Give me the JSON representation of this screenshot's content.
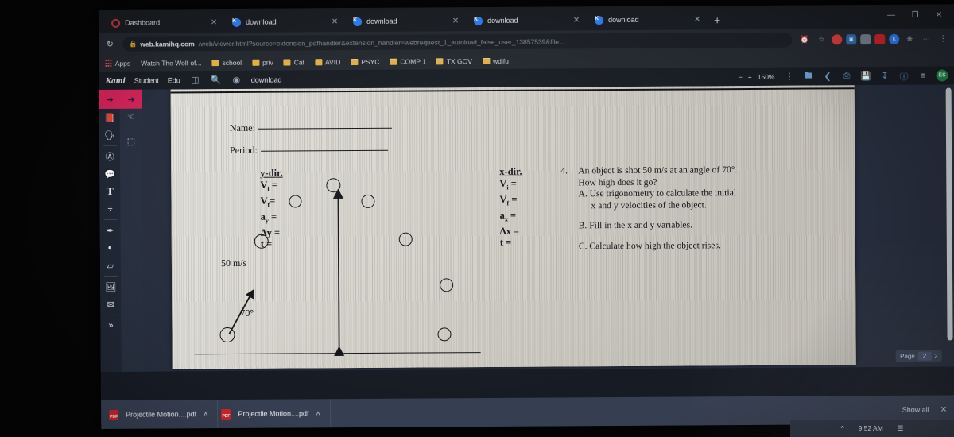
{
  "browser": {
    "tabs": [
      {
        "title": "Dashboard",
        "favicon": "canvas-icon",
        "active": false
      },
      {
        "title": "download",
        "favicon": "kami-icon",
        "active": false
      },
      {
        "title": "download",
        "favicon": "kami-icon",
        "active": false
      },
      {
        "title": "download",
        "favicon": "kami-icon",
        "active": true
      },
      {
        "title": "download",
        "favicon": "kami-icon",
        "active": false
      }
    ],
    "new_tab_label": "+",
    "window_controls": {
      "minimize": "—",
      "maximize": "❐",
      "close": "✕"
    },
    "reload_icon": "reload-icon",
    "lock_icon": "lock-icon",
    "url_host": "web.kamihq.com",
    "url_path": "/web/viewer.html?source=extension_pdfhandler&extension_handler=webrequest_1_autoload_false_user_13857539&file...",
    "omnibox_icons": [
      "clock-icon",
      "star-icon"
    ],
    "extensions": [
      "record-icon",
      "copy-icon",
      "screencast-icon",
      "adobe-icon",
      "kami-ext-icon",
      "puzzle-icon",
      "update-icon",
      "menu-icon"
    ],
    "bookmarks": {
      "apps_label": "Apps",
      "items": [
        {
          "label": "Watch The Wolf of...",
          "icon": "none"
        },
        {
          "label": "school",
          "icon": "folder-icon"
        },
        {
          "label": "priv",
          "icon": "folder-icon"
        },
        {
          "label": "Cat",
          "icon": "folder-icon"
        },
        {
          "label": "AVID",
          "icon": "folder-icon"
        },
        {
          "label": "PSYC",
          "icon": "folder-icon"
        },
        {
          "label": "COMP 1",
          "icon": "folder-icon"
        },
        {
          "label": "TX GOV",
          "icon": "folder-icon"
        },
        {
          "label": "wdifu",
          "icon": "folder-icon"
        }
      ]
    }
  },
  "kami": {
    "logo": "Kami",
    "menu": [
      "Student",
      "Edu"
    ],
    "split_view_icon": "split-view-icon",
    "search_icon": "search-icon",
    "globe_icon": "globe-icon",
    "file_name": "download",
    "zoom": {
      "minus": "−",
      "plus": "+",
      "level": "150%"
    },
    "right_tools": [
      {
        "name": "more-options-icon",
        "glyph": "⋮"
      },
      {
        "name": "folder-icon",
        "glyph": "Ὄ1"
      },
      {
        "name": "share-icon",
        "glyph": "⟨"
      },
      {
        "name": "print-icon",
        "glyph": "⎙"
      },
      {
        "name": "save-icon",
        "glyph": "὚b"
      },
      {
        "name": "download-icon",
        "glyph": "⤓"
      },
      {
        "name": "help-icon",
        "glyph": "?"
      },
      {
        "name": "hamburger-menu-icon",
        "glyph": "≡"
      }
    ],
    "avatar_initials": "ES",
    "sidebar_tools": [
      {
        "name": "select-tool",
        "glyph": "↖"
      },
      {
        "name": "dictionary-tool",
        "glyph": "Ὅ5"
      },
      {
        "name": "read-aloud-tool",
        "glyph": "὞3"
      },
      {
        "name": "annotate-tool",
        "glyph": "Ⓐ"
      },
      {
        "name": "comment-tool",
        "glyph": "Ὂc"
      },
      {
        "name": "text-tool",
        "glyph": "T"
      },
      {
        "name": "equation-tool",
        "glyph": "÷"
      },
      {
        "name": "highlight-tool",
        "glyph": "✒"
      },
      {
        "name": "shapes-tool",
        "glyph": "◐"
      },
      {
        "name": "eraser-tool",
        "glyph": "▱"
      },
      {
        "name": "image-tool",
        "glyph": "Ὓc"
      },
      {
        "name": "signature-tool",
        "glyph": "✍"
      },
      {
        "name": "more-tools",
        "glyph": "»"
      }
    ],
    "sidebar_secondary": [
      {
        "name": "hand-tool",
        "glyph": "☝"
      },
      {
        "name": "area-select-tool",
        "glyph": "⬚"
      }
    ],
    "page_nav": {
      "label": "Page",
      "current": "2",
      "total": "2"
    }
  },
  "document": {
    "name_label": "Name:",
    "period_label": "Period:",
    "y_column": {
      "heading": "y-dir.",
      "rows": [
        "V",
        "V",
        "a",
        "Δy =",
        "t ="
      ],
      "lines": [
        {
          "base": "V",
          "sub": "i",
          "tail": " ="
        },
        {
          "base": "V",
          "sub": "f",
          "tail": "="
        },
        {
          "base": "a",
          "sub": "y",
          "tail": " ="
        },
        {
          "base": "Δy",
          "sub": "",
          "tail": " ="
        },
        {
          "base": "t",
          "sub": "",
          "tail": " ="
        }
      ]
    },
    "x_column": {
      "heading": "x-dir.",
      "lines": [
        {
          "base": "V",
          "sub": "i",
          "tail": " ="
        },
        {
          "base": "V",
          "sub": "f",
          "tail": " ="
        },
        {
          "base": "a",
          "sub": "x",
          "tail": " ="
        },
        {
          "base": "Δx",
          "sub": "",
          "tail": " ="
        },
        {
          "base": "t",
          "sub": "",
          "tail": " ="
        }
      ]
    },
    "question": {
      "number": "4.",
      "stem_line1": "An object is shot 50 m/s at an angle of 70°.",
      "stem_line2": "How high does it go?",
      "part_a_line1": "A. Use trigonometry to calculate the initial",
      "part_a_line2": "x and y velocities of the object.",
      "part_b": "B. Fill in the x and y variables.",
      "part_c": "C. Calculate how  high the object rises."
    },
    "diagram": {
      "speed_label": "50 m/s",
      "angle_label": "70°"
    }
  },
  "downloads_shelf": {
    "items": [
      {
        "name": "Projectile Motion....pdf",
        "icon": "pdf-icon",
        "caret": "˄"
      },
      {
        "name": "Projectile Motion....pdf",
        "icon": "pdf-icon",
        "caret": "˄"
      }
    ],
    "show_all": "Show all",
    "close": "✕"
  },
  "taskbar": {
    "time": "9:52 AM"
  },
  "colors": {
    "accent_pink": "#e0245e",
    "chrome_dark": "#282c34",
    "kami_blue": "#2d7ff9",
    "paper": "#d8d5cd"
  }
}
